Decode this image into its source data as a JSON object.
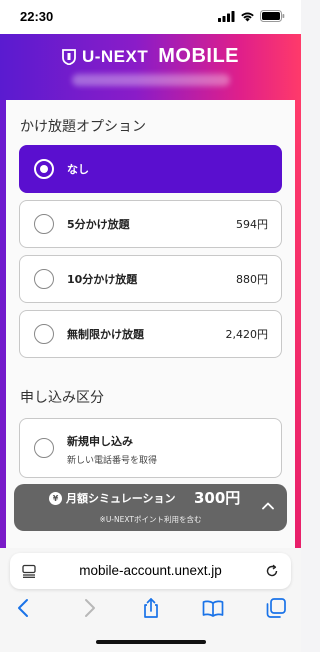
{
  "status_bar": {
    "time": "22:30"
  },
  "brand": {
    "name": "U-NEXT",
    "product": "MOBILE"
  },
  "call_options": {
    "title": "かけ放題オプション",
    "items": [
      {
        "label": "なし",
        "price": "",
        "selected": true
      },
      {
        "label": "5分かけ放題",
        "price": "594円",
        "selected": false
      },
      {
        "label": "10分かけ放題",
        "price": "880円",
        "selected": false
      },
      {
        "label": "無制限かけ放題",
        "price": "2,420円",
        "selected": false
      }
    ]
  },
  "application_type": {
    "title": "申し込み区分",
    "items": [
      {
        "label": "新規申し込み",
        "sublabel": "新しい電話番号を取得",
        "selected": false
      }
    ]
  },
  "simulation": {
    "label": "月額シミュレーション",
    "amount": "300円",
    "note": "※U-NEXTポイント利用を含む"
  },
  "browser": {
    "url": "mobile-account.unext.jp"
  },
  "colors": {
    "accent": "#5a0fcf",
    "gradient_start": "#5a1bd0",
    "gradient_end": "#ff3a6a"
  }
}
